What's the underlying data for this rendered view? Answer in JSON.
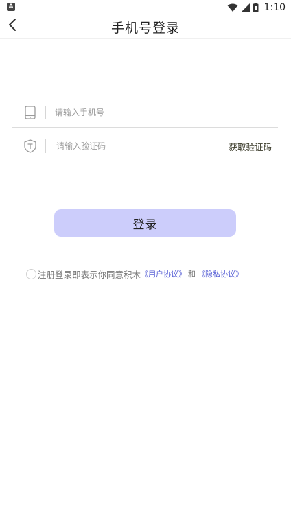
{
  "status_bar": {
    "app_icon_letter": "A",
    "time": "1:10"
  },
  "header": {
    "title": "手机号登录"
  },
  "form": {
    "phone_placeholder": "请输入手机号",
    "code_placeholder": "请输入验证码",
    "get_code_label": "获取验证码"
  },
  "login_button_label": "登录",
  "agreement": {
    "text": "注册登录即表示你同意积木",
    "user_agreement_link": "《用户协议》",
    "and_text": "和",
    "privacy_link": "《隐私协议》"
  },
  "colors": {
    "login_button_bg": "#cccdfb",
    "link": "#5a62d6"
  },
  "icons": {
    "back": "chevron-left-icon",
    "phone": "phone-icon",
    "code": "shield-icon"
  }
}
